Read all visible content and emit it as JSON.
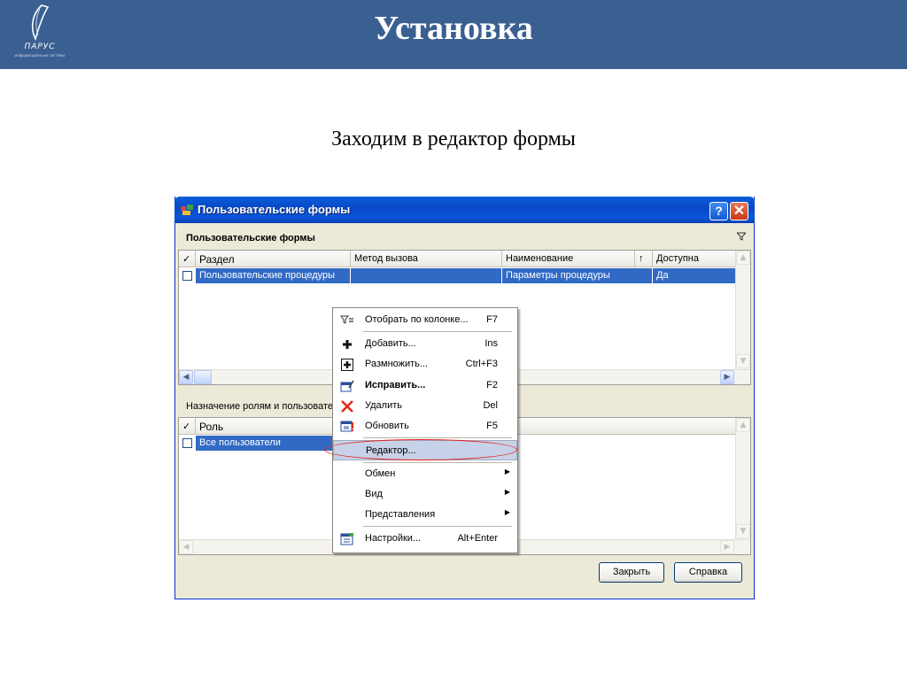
{
  "slide": {
    "title": "Установка",
    "subtitle": "Заходим в редактор формы",
    "logo": {
      "name": "ПАРУС",
      "sub": "информационные системы"
    }
  },
  "window": {
    "title": "Пользовательские формы",
    "help_button": "?",
    "close_button": "✕",
    "upper_panel": {
      "caption": "Пользовательские формы",
      "columns": [
        "✓",
        "Раздел",
        "Метод вызова",
        "Наименование",
        "↑",
        "Доступна"
      ],
      "rows": [
        {
          "section": "Пользовательские процедуры",
          "method": "",
          "name": "Параметры процедуры",
          "available": "Да"
        }
      ]
    },
    "lower_panel": {
      "caption": "Назначение ролям и пользователям",
      "columns": [
        "✓",
        "Роль"
      ],
      "rows": [
        {
          "role": "Все пользователи"
        }
      ]
    },
    "buttons": {
      "close": "Закрыть",
      "help": "Справка"
    }
  },
  "context_menu": {
    "items": [
      {
        "label": "Отобрать по колонке...",
        "key": "F7",
        "icon": "filter-icon"
      },
      {
        "label": "Добавить...",
        "key": "Ins",
        "icon": "plus-icon"
      },
      {
        "label": "Размножить...",
        "key": "Ctrl+F3",
        "icon": "duplicate-icon"
      },
      {
        "label": "Исправить...",
        "key": "F2",
        "icon": "edit-icon",
        "bold": true
      },
      {
        "label": "Удалить",
        "key": "Del",
        "icon": "delete-icon"
      },
      {
        "label": "Обновить",
        "key": "F5",
        "icon": "refresh-icon"
      },
      {
        "label": "Редактор...",
        "key": "",
        "icon": "",
        "selected": true
      },
      {
        "label": "Обмен",
        "key": "",
        "icon": "",
        "submenu": true
      },
      {
        "label": "Вид",
        "key": "",
        "icon": "",
        "submenu": true
      },
      {
        "label": "Представления",
        "key": "",
        "icon": "",
        "submenu": true
      },
      {
        "label": "Настройки...",
        "key": "Alt+Enter",
        "icon": "settings-icon"
      }
    ]
  },
  "colors": {
    "slide_header": "#3a5f91",
    "selection": "#316ac5",
    "highlight_ring": "#e02020"
  }
}
